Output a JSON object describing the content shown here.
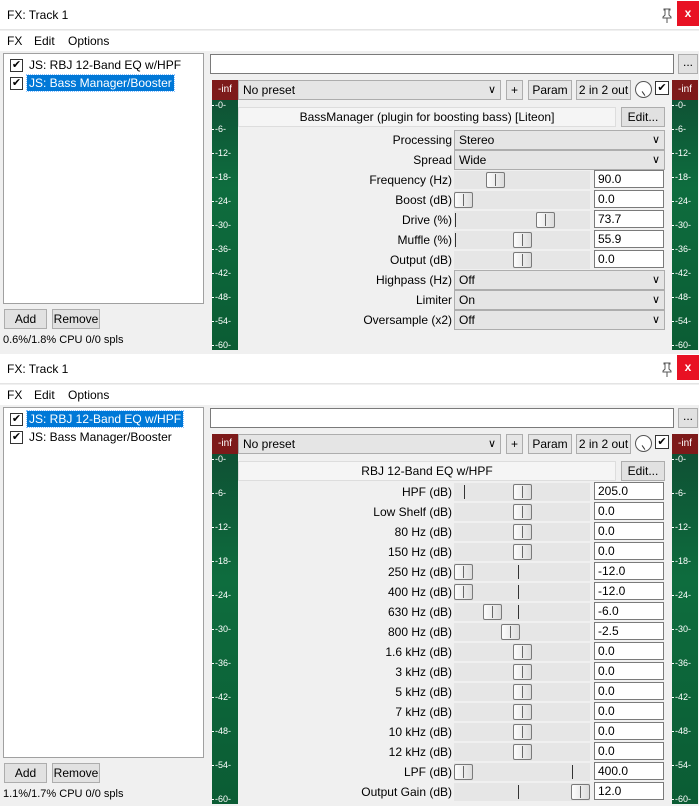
{
  "windows": [
    {
      "title": "FX: Track 1",
      "close_label": "x",
      "menu": [
        "FX",
        "Edit",
        "Options"
      ],
      "chain": [
        {
          "label": "JS: RBJ 12-Band EQ w/HPF",
          "checked": true,
          "selected": false
        },
        {
          "label": "JS: Bass Manager/Booster",
          "checked": true,
          "selected": true
        }
      ],
      "add_label": "Add",
      "remove_label": "Remove",
      "cpu": "0.6%/1.8% CPU 0/0 spls",
      "dots_label": "...",
      "preset": "No preset",
      "plus_label": "+",
      "param_label": "Param",
      "io_label": "2 in 2 out",
      "plugin_name": "BassManager (plugin for boosting bass) [Liteon]",
      "edit_label": "Edit...",
      "meter": {
        "top_label": "-inf",
        "ticks": [
          "-0-",
          "-6-",
          "-12-",
          "-18-",
          "-24-",
          "-30-",
          "-36-",
          "-42-",
          "-48-",
          "-54-",
          "-60-"
        ]
      },
      "params": [
        {
          "kind": "dropdown",
          "label": "Processing",
          "value": "Stereo"
        },
        {
          "kind": "dropdown",
          "label": "Spread",
          "value": "Wide"
        },
        {
          "kind": "slider",
          "label": "Frequency (Hz)",
          "value": "90.0",
          "pos": 0.27,
          "center": null
        },
        {
          "kind": "slider",
          "label": "Boost (dB)",
          "value": "0.0",
          "pos": 0.0,
          "center": null
        },
        {
          "kind": "slider",
          "label": "Drive (%)",
          "value": "73.7",
          "pos": 0.7,
          "center": 0.0
        },
        {
          "kind": "slider",
          "label": "Muffle (%)",
          "value": "55.9",
          "pos": 0.5,
          "center": 0.0
        },
        {
          "kind": "slider",
          "label": "Output (dB)",
          "value": "0.0",
          "pos": 0.5,
          "center": null
        },
        {
          "kind": "dropdown",
          "label": "Highpass (Hz)",
          "value": "Off"
        },
        {
          "kind": "dropdown",
          "label": "Limiter",
          "value": "On"
        },
        {
          "kind": "dropdown",
          "label": "Oversample (x2)",
          "value": "Off"
        }
      ]
    },
    {
      "title": "FX: Track 1",
      "close_label": "x",
      "menu": [
        "FX",
        "Edit",
        "Options"
      ],
      "chain": [
        {
          "label": "JS: RBJ 12-Band EQ w/HPF",
          "checked": true,
          "selected": true
        },
        {
          "label": "JS: Bass Manager/Booster",
          "checked": true,
          "selected": false
        }
      ],
      "add_label": "Add",
      "remove_label": "Remove",
      "cpu": "1.1%/1.7% CPU 0/0 spls",
      "dots_label": "...",
      "preset": "No preset",
      "plus_label": "+",
      "param_label": "Param",
      "io_label": "2 in 2 out",
      "plugin_name": "RBJ 12-Band EQ w/HPF",
      "edit_label": "Edit...",
      "meter": {
        "top_label": "-inf",
        "ticks": [
          "-0-",
          "-6-",
          "-12-",
          "-18-",
          "-24-",
          "-30-",
          "-36-",
          "-42-",
          "-48-",
          "-54-",
          "-60-"
        ]
      },
      "params": [
        {
          "kind": "slider",
          "label": "HPF (dB)",
          "value": "205.0",
          "pos": 0.5,
          "center": 0.07
        },
        {
          "kind": "slider",
          "label": "Low Shelf (dB)",
          "value": "0.0",
          "pos": 0.5,
          "center": 0.5
        },
        {
          "kind": "slider",
          "label": "80 Hz (dB)",
          "value": "0.0",
          "pos": 0.5,
          "center": 0.5
        },
        {
          "kind": "slider",
          "label": "150 Hz (dB)",
          "value": "0.0",
          "pos": 0.5,
          "center": 0.5
        },
        {
          "kind": "slider",
          "label": "250 Hz (dB)",
          "value": "-12.0",
          "pos": 0.0,
          "center": 0.5
        },
        {
          "kind": "slider",
          "label": "400 Hz (dB)",
          "value": "-12.0",
          "pos": 0.0,
          "center": 0.5
        },
        {
          "kind": "slider",
          "label": "630 Hz (dB)",
          "value": "-6.0",
          "pos": 0.25,
          "center": 0.5
        },
        {
          "kind": "slider",
          "label": "800 Hz (dB)",
          "value": "-2.5",
          "pos": 0.4,
          "center": 0.5
        },
        {
          "kind": "slider",
          "label": "1.6 kHz (dB)",
          "value": "0.0",
          "pos": 0.5,
          "center": 0.5
        },
        {
          "kind": "slider",
          "label": "3 kHz (dB)",
          "value": "0.0",
          "pos": 0.5,
          "center": 0.5
        },
        {
          "kind": "slider",
          "label": "5 kHz (dB)",
          "value": "0.0",
          "pos": 0.5,
          "center": 0.5
        },
        {
          "kind": "slider",
          "label": "7 kHz (dB)",
          "value": "0.0",
          "pos": 0.5,
          "center": 0.5
        },
        {
          "kind": "slider",
          "label": "10 kHz (dB)",
          "value": "0.0",
          "pos": 0.5,
          "center": 0.5
        },
        {
          "kind": "slider",
          "label": "12 kHz (dB)",
          "value": "0.0",
          "pos": 0.5,
          "center": 0.5
        },
        {
          "kind": "slider",
          "label": "LPF (dB)",
          "value": "400.0",
          "pos": 0.0,
          "center": 0.93
        },
        {
          "kind": "slider",
          "label": "Output Gain (dB)",
          "value": "12.0",
          "pos": 1.0,
          "center": 0.5
        }
      ]
    }
  ]
}
